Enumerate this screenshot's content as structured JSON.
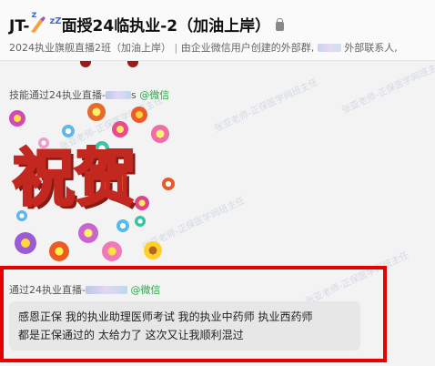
{
  "header": {
    "title_prefix": "JT-",
    "title_main": "面授24临执业-2（加油上岸）",
    "subtitle_left": "2024执业旗舰直播2班（加油上岸）",
    "subtitle_right": "由企业微信用户创建的外部群,",
    "subtitle_external": "外部联系人,"
  },
  "messages": [
    {
      "sender_name": "技能通过24执业直播-",
      "sender_suffix": "s",
      "sender_channel": "@微信",
      "type": "sticker",
      "sticker_text": "祝贺"
    },
    {
      "sender_name": "通过24执业直播-",
      "sender_channel": "@微信",
      "type": "text",
      "text_line1": "感恩正保  我的执业助理医师考试 我的执业中药师  执业西药师",
      "text_line2": "都是正保通过的  太给力了  这次又让我顺利混过"
    }
  ],
  "watermark": "张亚老师-正保医学网班主任",
  "colors": {
    "highlight_border": "#e60000",
    "wechat_green": "#2aa64a"
  }
}
